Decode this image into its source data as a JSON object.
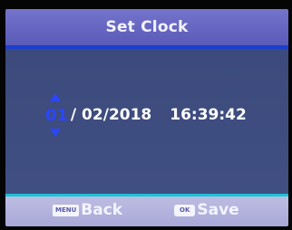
{
  "header": {
    "title": "Set Clock"
  },
  "datetime": {
    "day": "01",
    "separator1": " / ",
    "month": "02",
    "separator2": "/",
    "year": "2018",
    "time": "16:39:42"
  },
  "footer": {
    "back_key": "MENU",
    "back_label": "Back",
    "save_key": "OK",
    "save_label": "Save"
  },
  "colors": {
    "header": "#6a6ac4",
    "panel": "#3e4c80",
    "selected_field": "#2a46ff",
    "footer": "#b2b2dc",
    "footer_rule": "#19c4d8"
  },
  "icons": {
    "increase": "arrow-up-icon",
    "decrease": "arrow-down-icon"
  }
}
